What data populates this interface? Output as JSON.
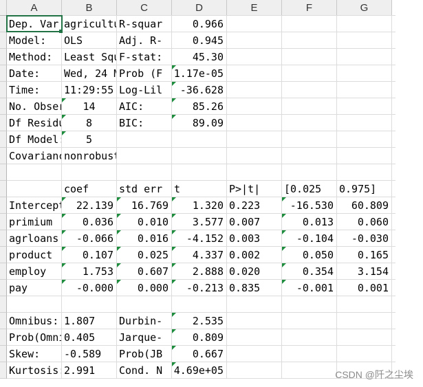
{
  "columns": [
    "A",
    "B",
    "C",
    "D",
    "E",
    "F",
    "G"
  ],
  "rows": [
    [
      "Dep. Var",
      "agricultu",
      "R-squar",
      "0.966",
      "",
      "",
      ""
    ],
    [
      "Model:",
      "OLS",
      "Adj. R-",
      "0.945",
      "",
      "",
      ""
    ],
    [
      "Method:",
      "Least Squ",
      "F-stat:",
      "45.30",
      "",
      "",
      ""
    ],
    [
      "Date:",
      "Wed, 24 M",
      "Prob (F",
      "1.17e-05",
      "",
      "",
      ""
    ],
    [
      "Time:",
      "11:29:55",
      "Log-Lil",
      "-36.628",
      "",
      "",
      ""
    ],
    [
      "No. Obser",
      "14",
      "AIC:",
      "85.26",
      "",
      "",
      ""
    ],
    [
      "Df Residu",
      "8",
      "BIC:",
      "89.09",
      "",
      "",
      ""
    ],
    [
      "Df Model:",
      "5",
      "",
      "",
      "",
      "",
      ""
    ],
    [
      "Covarianc",
      "nonrobust",
      "",
      "",
      "",
      "",
      ""
    ],
    [
      "",
      "",
      "",
      "",
      "",
      "",
      ""
    ],
    [
      "",
      "coef",
      "std err",
      "t",
      "P>|t|",
      "[0.025",
      "0.975]"
    ],
    [
      "Intercept",
      "22.139",
      "16.769",
      "1.320",
      "0.223",
      "-16.530",
      "60.809"
    ],
    [
      "primium",
      "0.036",
      "0.010",
      "3.577",
      "0.007",
      "0.013",
      "0.060"
    ],
    [
      "agrloans",
      "-0.066",
      "0.016",
      "-4.152",
      "0.003",
      "-0.104",
      "-0.030"
    ],
    [
      "product",
      "0.107",
      "0.025",
      "4.337",
      "0.002",
      "0.050",
      "0.165"
    ],
    [
      "employ",
      "1.753",
      "0.607",
      "2.888",
      "0.020",
      "0.354",
      "3.154"
    ],
    [
      "pay",
      "-0.000",
      "0.000",
      "-0.213",
      "0.835",
      "-0.001",
      "0.001"
    ],
    [
      "",
      "",
      "",
      "",
      "",
      "",
      ""
    ],
    [
      "Omnibus:",
      "1.807",
      "Durbin-",
      "2.535",
      "",
      "",
      ""
    ],
    [
      "Prob(Omni",
      "0.405",
      "Jarque-",
      "0.809",
      "",
      "",
      ""
    ],
    [
      "Skew:",
      "-0.589",
      "Prob(JB",
      "0.667",
      "",
      "",
      ""
    ],
    [
      "Kurtosis:",
      "2.991",
      "Cond. N",
      "4.69e+05",
      "",
      "",
      ""
    ]
  ],
  "watermark": "CSDN @阡之尘埃",
  "colors": {
    "grid": "#dcdcdc",
    "header_bg": "#efefef",
    "selection": "#217346",
    "error_triangle": "#1e8e3e"
  }
}
